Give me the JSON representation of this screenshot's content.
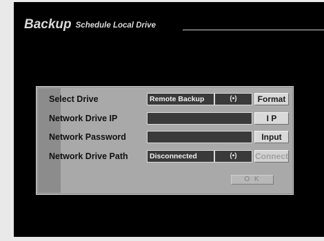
{
  "header": {
    "title": "Backup",
    "subtitle": "Schedule Local Drive"
  },
  "rows": {
    "select_drive": {
      "label": "Select Drive",
      "value": "Remote Backup",
      "icon": "(•)",
      "button": "Format"
    },
    "network_ip": {
      "label": "Network Drive IP",
      "value": "",
      "button": "I P"
    },
    "network_password": {
      "label": "Network Password",
      "value": "",
      "button": "Input"
    },
    "network_path": {
      "label": "Network Drive Path",
      "value": "Disconnected",
      "icon": "(•)",
      "button": "Connect"
    }
  },
  "ok_label": "O K",
  "colors": {
    "screen": "#000000",
    "panel": "#a9a9a9",
    "field": "#3a3a3a",
    "button": "#d9d9d9"
  }
}
